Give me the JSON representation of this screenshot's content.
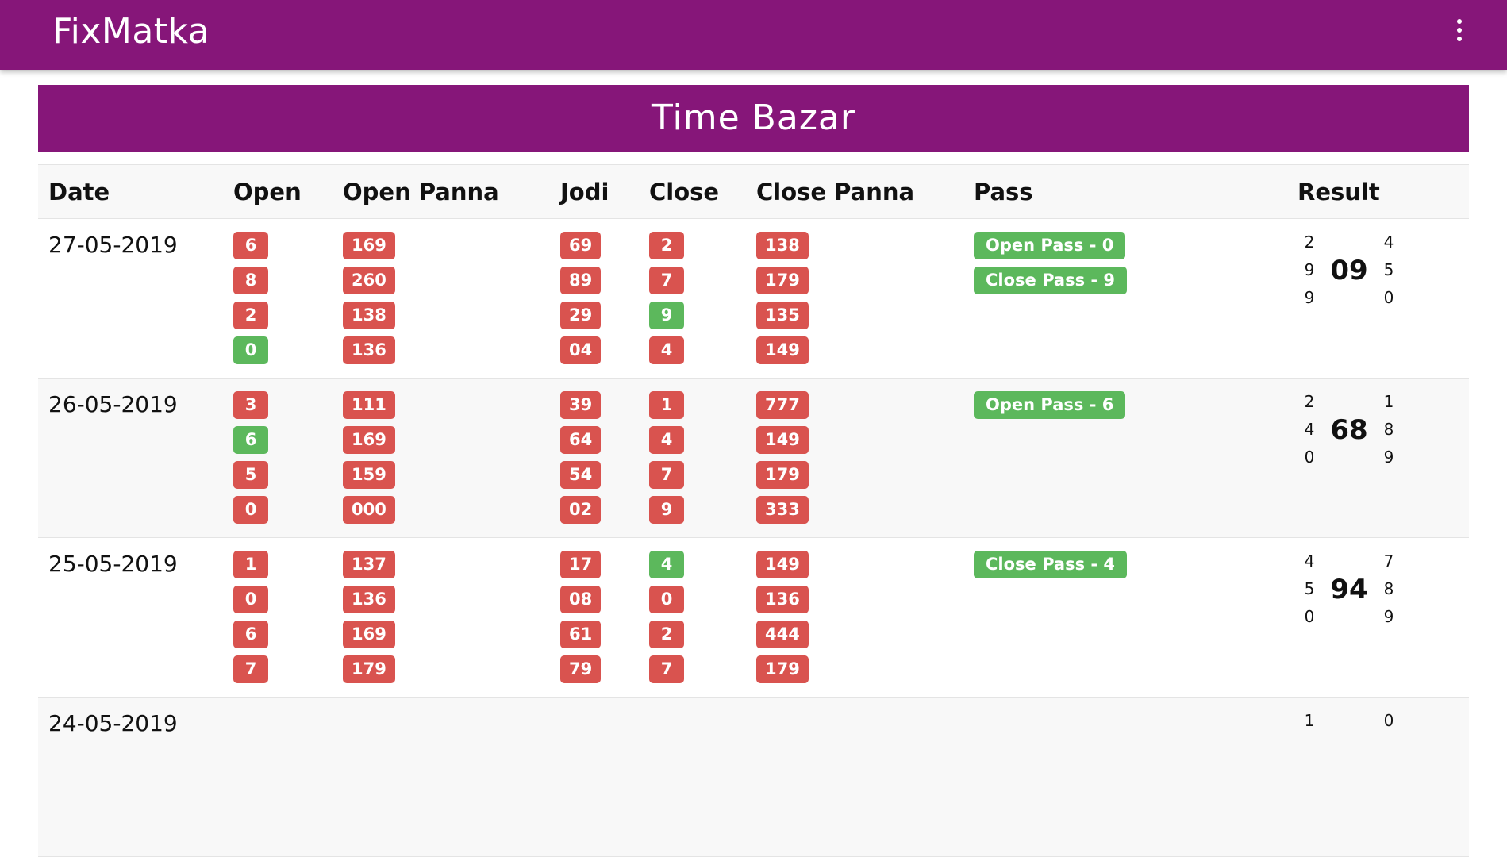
{
  "app": {
    "brand": "FixMatka",
    "menu_icon": "more-vertical-icon"
  },
  "bazar": {
    "title": "Time Bazar"
  },
  "colors": {
    "primary": "#861679",
    "badge_red": "#d9534f",
    "badge_green": "#5cb85c"
  },
  "table": {
    "headers": {
      "date": "Date",
      "open": "Open",
      "open_panna": "Open Panna",
      "jodi": "Jodi",
      "close": "Close",
      "close_panna": "Close Panna",
      "pass": "Pass",
      "result": "Result"
    },
    "rows": [
      {
        "date": "27-05-2019",
        "open": [
          {
            "v": "6",
            "c": "red"
          },
          {
            "v": "8",
            "c": "red"
          },
          {
            "v": "2",
            "c": "red"
          },
          {
            "v": "0",
            "c": "green"
          }
        ],
        "open_panna": [
          {
            "v": "169",
            "c": "red"
          },
          {
            "v": "260",
            "c": "red"
          },
          {
            "v": "138",
            "c": "red"
          },
          {
            "v": "136",
            "c": "red"
          }
        ],
        "jodi": [
          {
            "v": "69",
            "c": "red"
          },
          {
            "v": "89",
            "c": "red"
          },
          {
            "v": "29",
            "c": "red"
          },
          {
            "v": "04",
            "c": "red"
          }
        ],
        "close": [
          {
            "v": "2",
            "c": "red"
          },
          {
            "v": "7",
            "c": "red"
          },
          {
            "v": "9",
            "c": "green"
          },
          {
            "v": "4",
            "c": "red"
          }
        ],
        "close_panna": [
          {
            "v": "138",
            "c": "red"
          },
          {
            "v": "179",
            "c": "red"
          },
          {
            "v": "135",
            "c": "red"
          },
          {
            "v": "149",
            "c": "red"
          }
        ],
        "pass": [
          "Open Pass - 0",
          "Close Pass - 9"
        ],
        "result": {
          "left": [
            "2",
            "9",
            "9"
          ],
          "jodi": "09",
          "right": [
            "4",
            "5",
            "0"
          ]
        }
      },
      {
        "date": "26-05-2019",
        "open": [
          {
            "v": "3",
            "c": "red"
          },
          {
            "v": "6",
            "c": "green"
          },
          {
            "v": "5",
            "c": "red"
          },
          {
            "v": "0",
            "c": "red"
          }
        ],
        "open_panna": [
          {
            "v": "111",
            "c": "red"
          },
          {
            "v": "169",
            "c": "red"
          },
          {
            "v": "159",
            "c": "red"
          },
          {
            "v": "000",
            "c": "red"
          }
        ],
        "jodi": [
          {
            "v": "39",
            "c": "red"
          },
          {
            "v": "64",
            "c": "red"
          },
          {
            "v": "54",
            "c": "red"
          },
          {
            "v": "02",
            "c": "red"
          }
        ],
        "close": [
          {
            "v": "1",
            "c": "red"
          },
          {
            "v": "4",
            "c": "red"
          },
          {
            "v": "7",
            "c": "red"
          },
          {
            "v": "9",
            "c": "red"
          }
        ],
        "close_panna": [
          {
            "v": "777",
            "c": "red"
          },
          {
            "v": "149",
            "c": "red"
          },
          {
            "v": "179",
            "c": "red"
          },
          {
            "v": "333",
            "c": "red"
          }
        ],
        "pass": [
          "Open Pass - 6"
        ],
        "result": {
          "left": [
            "2",
            "4",
            "0"
          ],
          "jodi": "68",
          "right": [
            "1",
            "8",
            "9"
          ]
        }
      },
      {
        "date": "25-05-2019",
        "open": [
          {
            "v": "1",
            "c": "red"
          },
          {
            "v": "0",
            "c": "red"
          },
          {
            "v": "6",
            "c": "red"
          },
          {
            "v": "7",
            "c": "red"
          }
        ],
        "open_panna": [
          {
            "v": "137",
            "c": "red"
          },
          {
            "v": "136",
            "c": "red"
          },
          {
            "v": "169",
            "c": "red"
          },
          {
            "v": "179",
            "c": "red"
          }
        ],
        "jodi": [
          {
            "v": "17",
            "c": "red"
          },
          {
            "v": "08",
            "c": "red"
          },
          {
            "v": "61",
            "c": "red"
          },
          {
            "v": "79",
            "c": "red"
          }
        ],
        "close": [
          {
            "v": "4",
            "c": "green"
          },
          {
            "v": "0",
            "c": "red"
          },
          {
            "v": "2",
            "c": "red"
          },
          {
            "v": "7",
            "c": "red"
          }
        ],
        "close_panna": [
          {
            "v": "149",
            "c": "red"
          },
          {
            "v": "136",
            "c": "red"
          },
          {
            "v": "444",
            "c": "red"
          },
          {
            "v": "179",
            "c": "red"
          }
        ],
        "pass": [
          "Close Pass - 4"
        ],
        "result": {
          "left": [
            "4",
            "5",
            "0"
          ],
          "jodi": "94",
          "right": [
            "7",
            "8",
            "9"
          ]
        }
      },
      {
        "date": "24-05-2019",
        "open": [
          {
            "v": "",
            "c": "red"
          }
        ],
        "open_panna": [
          {
            "v": "",
            "c": "red"
          }
        ],
        "jodi": [
          {
            "v": "",
            "c": "red"
          }
        ],
        "close": [
          {
            "v": "",
            "c": "red"
          }
        ],
        "close_panna": [
          {
            "v": "",
            "c": "red"
          }
        ],
        "pass": [],
        "result": {
          "left": [
            "1"
          ],
          "jodi": "",
          "right": [
            "0"
          ]
        }
      }
    ]
  }
}
